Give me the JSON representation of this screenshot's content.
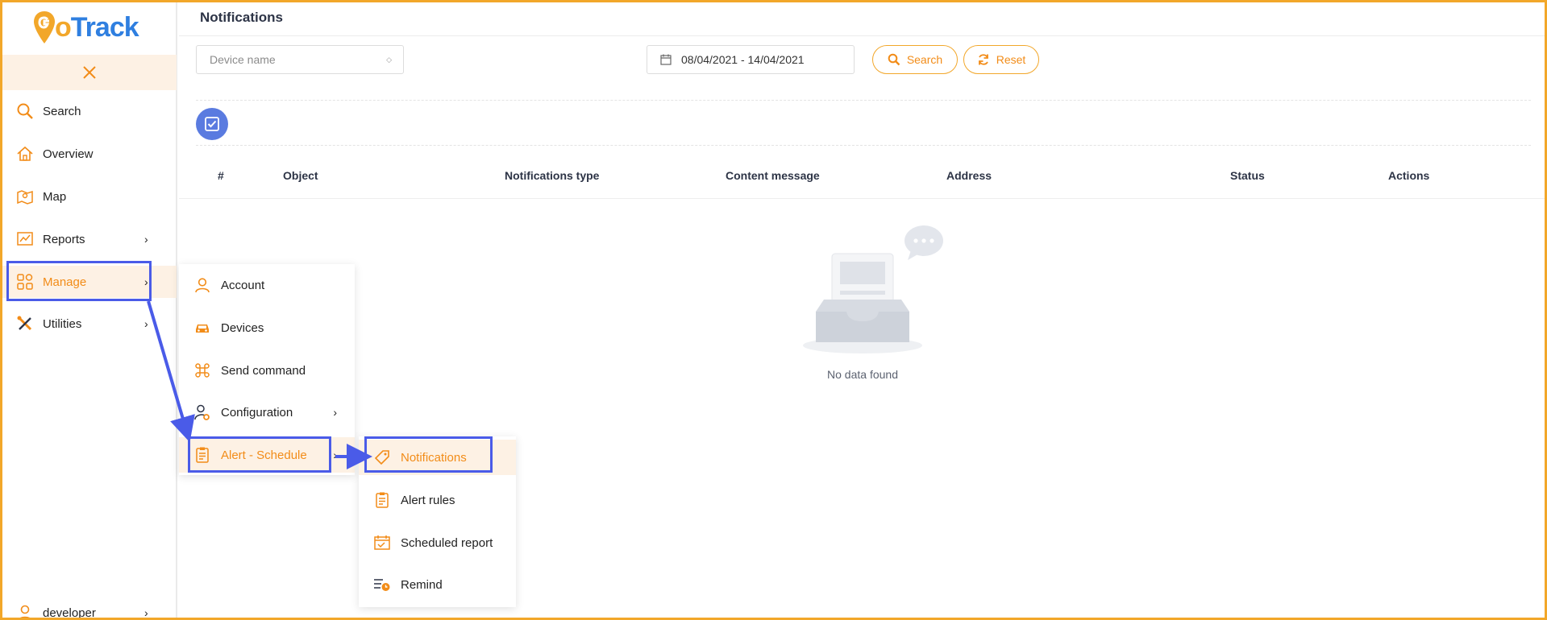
{
  "app": {
    "logo_text_prefix": "G",
    "logo_text_o": "o",
    "logo_text_rest": "Track"
  },
  "colors": {
    "accent": "#f28c18",
    "brand_blue": "#2f7fe0",
    "highlight": "#4a5be8",
    "check_btn": "#5a7be0"
  },
  "sidebar": {
    "items": [
      {
        "label": "Search",
        "icon": "search-icon"
      },
      {
        "label": "Overview",
        "icon": "home-icon"
      },
      {
        "label": "Map",
        "icon": "map-icon"
      },
      {
        "label": "Reports",
        "icon": "chart-icon"
      },
      {
        "label": "Manage",
        "icon": "grid-icon"
      },
      {
        "label": "Utilities",
        "icon": "tools-icon"
      }
    ],
    "user": {
      "label": "developer",
      "icon": "user-icon"
    }
  },
  "header": {
    "title": "Notifications"
  },
  "filters": {
    "device_placeholder": "Device name",
    "date_range": "08/04/2021 - 14/04/2021",
    "search_label": "Search",
    "reset_label": "Reset"
  },
  "table": {
    "columns": [
      "#",
      "Object",
      "Notifications type",
      "Content message",
      "Address",
      "Status",
      "Actions"
    ],
    "empty_text": "No data found"
  },
  "manage_menu": {
    "items": [
      {
        "label": "Account",
        "icon": "user-icon"
      },
      {
        "label": "Devices",
        "icon": "car-icon"
      },
      {
        "label": "Send command",
        "icon": "command-icon"
      },
      {
        "label": "Configuration",
        "icon": "user-gear-icon"
      },
      {
        "label": "Alert - Schedule",
        "icon": "clipboard-icon"
      }
    ]
  },
  "alert_menu": {
    "items": [
      {
        "label": "Notifications",
        "icon": "tag-icon"
      },
      {
        "label": "Alert rules",
        "icon": "clipboard-icon"
      },
      {
        "label": "Scheduled report",
        "icon": "calendar-check-icon"
      },
      {
        "label": "Remind",
        "icon": "list-clock-icon"
      }
    ]
  }
}
